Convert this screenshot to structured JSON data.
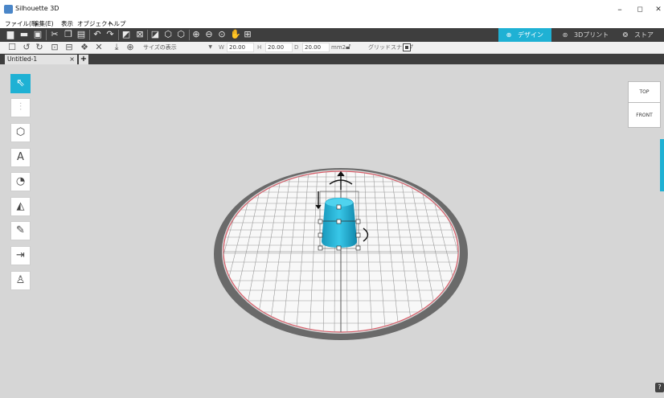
{
  "app": {
    "title": "Silhouette 3D"
  },
  "window_controls": {
    "minimize": "–",
    "maximize": "◻",
    "close": "✕"
  },
  "menu": [
    "ファイル(F)",
    "編集(E)",
    "表示",
    "オブジェクト",
    "ヘルプ"
  ],
  "toolbar_main": {
    "icons": [
      "new-file-icon",
      "open-folder-icon",
      "save-icon",
      "cut-icon",
      "copy-icon",
      "paste-icon",
      "undo-icon",
      "redo-icon",
      "move-to-back-icon",
      "delete-icon",
      "show-hide-icon",
      "object-view-icon",
      "duplicate-view-icon",
      "zoom-in-icon",
      "zoom-out-icon",
      "zoom-fit-icon",
      "pan-hand-icon",
      "grid-view-icon"
    ]
  },
  "mode_tabs": [
    {
      "label": "デザイン",
      "active": true,
      "icon": "globe-icon"
    },
    {
      "label": "3Dプリント",
      "active": false,
      "icon": "printer-icon"
    },
    {
      "label": "ストア",
      "active": false,
      "icon": "store-icon"
    }
  ],
  "toolbar_secondary": {
    "icons": [
      "select-box-icon",
      "rotate-left-icon",
      "rotate-right-icon",
      "align-icon",
      "distribute-icon",
      "group-icon",
      "delete-x-icon",
      "place-on-floor-icon",
      "add-circle-icon"
    ],
    "size_display": "サイズの表示",
    "w_label": "W",
    "w_value": "20.00",
    "h_label": "H",
    "h_value": "20.00",
    "d_label": "D",
    "d_value": "20.00",
    "unit": "mm2",
    "grid_snap_label": "グリッドスナップ",
    "grid_snap_enabled": true
  },
  "document_tab": {
    "title": "Untitled-1",
    "close": "×",
    "add": "+"
  },
  "left_tools": [
    {
      "name": "select-tool",
      "icon": "pointer-icon",
      "active": true
    },
    {
      "name": "alignment-tool",
      "icon": "align-icon",
      "active": false,
      "disabled": true
    },
    {
      "name": "basic-shapes-tool",
      "icon": "cube-icon",
      "active": false
    },
    {
      "name": "text-tool",
      "icon": "text-a-icon",
      "active": false
    },
    {
      "name": "shape-tool",
      "icon": "shapes-icon",
      "active": false
    },
    {
      "name": "extrude-tool",
      "icon": "prism-icon",
      "active": false
    },
    {
      "name": "knife-tool",
      "icon": "cutter-icon",
      "active": false
    },
    {
      "name": "import-tool",
      "icon": "import-icon",
      "active": false
    },
    {
      "name": "figure-tool",
      "icon": "figure-icon",
      "active": false
    }
  ],
  "view_cube": {
    "top": "TOP",
    "front": "FRONT"
  },
  "help": {
    "label": "?"
  },
  "colors": {
    "accent": "#1fb1d4",
    "toolbar": "#3e3e3e",
    "viewport": "#d6d6d6",
    "platform_rim": "#d85c68",
    "object": "#22b3d6"
  }
}
